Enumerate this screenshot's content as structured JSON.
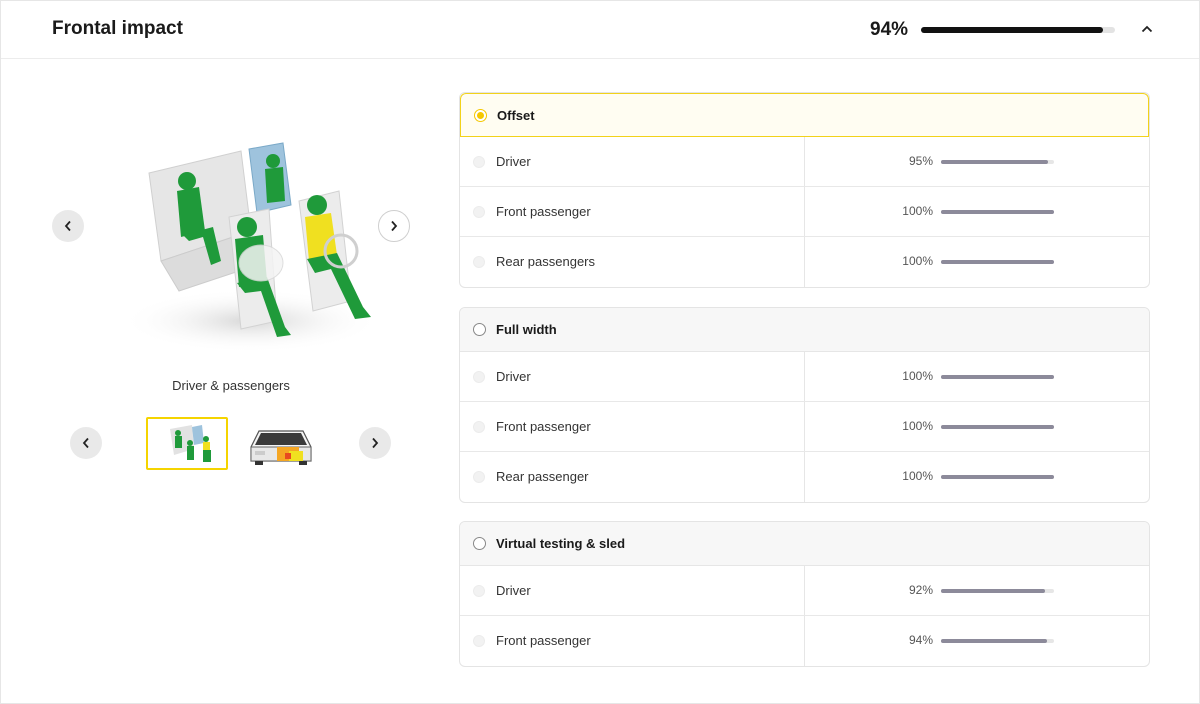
{
  "header": {
    "title": "Frontal impact",
    "score_label": "94%",
    "score_fraction": 0.94,
    "collapse_icon": "chevron-up-icon"
  },
  "gallery": {
    "caption": "Driver & passengers",
    "prev_icon": "chevron-left-icon",
    "next_icon": "chevron-right-icon",
    "thumbnails": [
      {
        "name": "dummies-thumbnail",
        "active": true
      },
      {
        "name": "car-front-thumbnail",
        "active": false
      }
    ]
  },
  "groups": [
    {
      "label": "Offset",
      "selected": true,
      "rows": [
        {
          "label": "Driver",
          "pct": "95%",
          "fraction": 0.95
        },
        {
          "label": "Front passenger",
          "pct": "100%",
          "fraction": 1.0
        },
        {
          "label": "Rear passengers",
          "pct": "100%",
          "fraction": 1.0
        }
      ]
    },
    {
      "label": "Full width",
      "selected": false,
      "rows": [
        {
          "label": "Driver",
          "pct": "100%",
          "fraction": 1.0
        },
        {
          "label": "Front passenger",
          "pct": "100%",
          "fraction": 1.0
        },
        {
          "label": "Rear passenger",
          "pct": "100%",
          "fraction": 1.0
        }
      ]
    },
    {
      "label": "Virtual testing & sled",
      "selected": false,
      "rows": [
        {
          "label": "Driver",
          "pct": "92%",
          "fraction": 0.92
        },
        {
          "label": "Front passenger",
          "pct": "94%",
          "fraction": 0.94
        }
      ]
    }
  ],
  "colors": {
    "accent_yellow": "#f5c800",
    "dummy_green": "#1f9a3a",
    "bar_fill": "#8c8a9a",
    "header_bar": "#111111"
  }
}
